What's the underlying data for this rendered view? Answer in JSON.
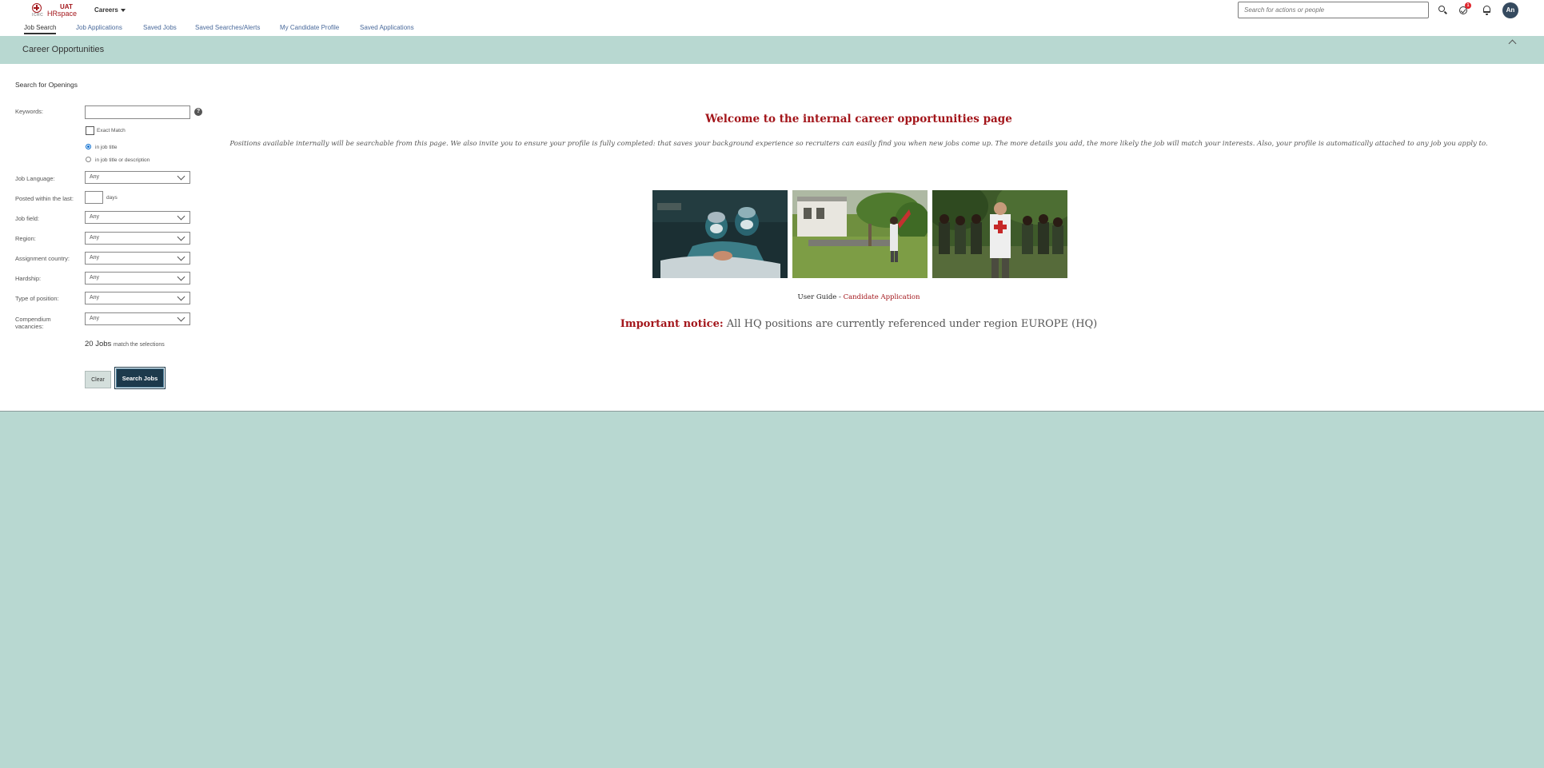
{
  "shell": {
    "logo_org": "ICRC",
    "logo_env": "UAT",
    "logo_brand": "HRspace",
    "product_menu": "Careers",
    "search_placeholder": "Search for actions or people",
    "notifications_badge": "1",
    "avatar_initials": "An"
  },
  "tabs": [
    {
      "label": "Job Search",
      "active": true
    },
    {
      "label": "Job Applications"
    },
    {
      "label": "Saved Jobs"
    },
    {
      "label": "Saved Searches/Alerts"
    },
    {
      "label": "My Candidate Profile"
    },
    {
      "label": "Saved Applications"
    }
  ],
  "page_title": "Career Opportunities",
  "search_form": {
    "title": "Search for Openings",
    "keywords_label": "Keywords:",
    "exact_match_label": "Exact Match",
    "radio_title_label": "in job title",
    "radio_desc_label": "in job title or description",
    "job_language_label": "Job Language:",
    "job_language_value": "Any",
    "posted_label": "Posted within the last:",
    "days_label": "days",
    "job_field_label": "Job field:",
    "job_field_value": "Any",
    "region_label": "Region:",
    "region_value": "Any",
    "assignment_country_label": "Assignment country:",
    "assignment_country_value": "Any",
    "hardship_label": "Hardship:",
    "hardship_value": "Any",
    "position_type_label": "Type of position:",
    "position_type_value": "Any",
    "compendium_label": "Compendium vacancies:",
    "compendium_value": "Any",
    "job_count": "20 Jobs",
    "job_count_suffix": "match the selections",
    "clear_label": "Clear",
    "search_label": "Search Jobs"
  },
  "welcome": {
    "title": "Welcome to the internal career opportunities page",
    "body": "Positions available internally will be searchable from this page. We also invite you to ensure your profile is fully completed: that saves your background experience so recruiters can easily find you when new jobs come up. The more details you add, the more likely the job will match your interests. Also, your profile is automatically attached to any job you apply to.",
    "guide_prefix": "User Guide - ",
    "guide_link": "Candidate Application",
    "notice_strong": "Important notice:",
    "notice_text": " All HQ positions are currently referenced under region EUROPE (HQ)"
  },
  "colors": {
    "accent_red": "#a3161b",
    "teal_background": "#b8d8d1",
    "primary_button": "#1d3a4c",
    "link_blue": "#4a6a9b"
  }
}
